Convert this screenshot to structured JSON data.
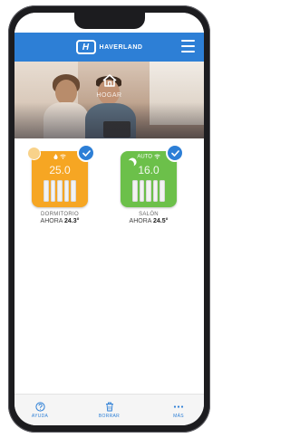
{
  "header": {
    "brand_name": "HAVERLAND",
    "brand_letter": "H"
  },
  "hero": {
    "label": "HOGAR"
  },
  "devices": [
    {
      "name": "DORMITORIO",
      "mode": "",
      "set_temp": "25.0",
      "now_label": "AHORA",
      "now_temp": "24.3°",
      "color": "#f6a623",
      "selected": true
    },
    {
      "name": "SALÓN",
      "mode": "AUTO",
      "set_temp": "16.0",
      "now_label": "AHORA",
      "now_temp": "24.5°",
      "color": "#6cc04a",
      "selected": true
    }
  ],
  "bottom_nav": {
    "help_label": "AYUDA",
    "delete_label": "BORRAR",
    "more_label": "MÁS"
  },
  "colors": {
    "accent": "#2d7fd6",
    "tile_orange": "#f6a623",
    "tile_green": "#6cc04a"
  },
  "icons": {
    "menu": "hamburger-icon",
    "home": "home-icon",
    "check": "check-icon",
    "help": "question-icon",
    "delete": "trash-icon",
    "more": "dots-icon"
  }
}
